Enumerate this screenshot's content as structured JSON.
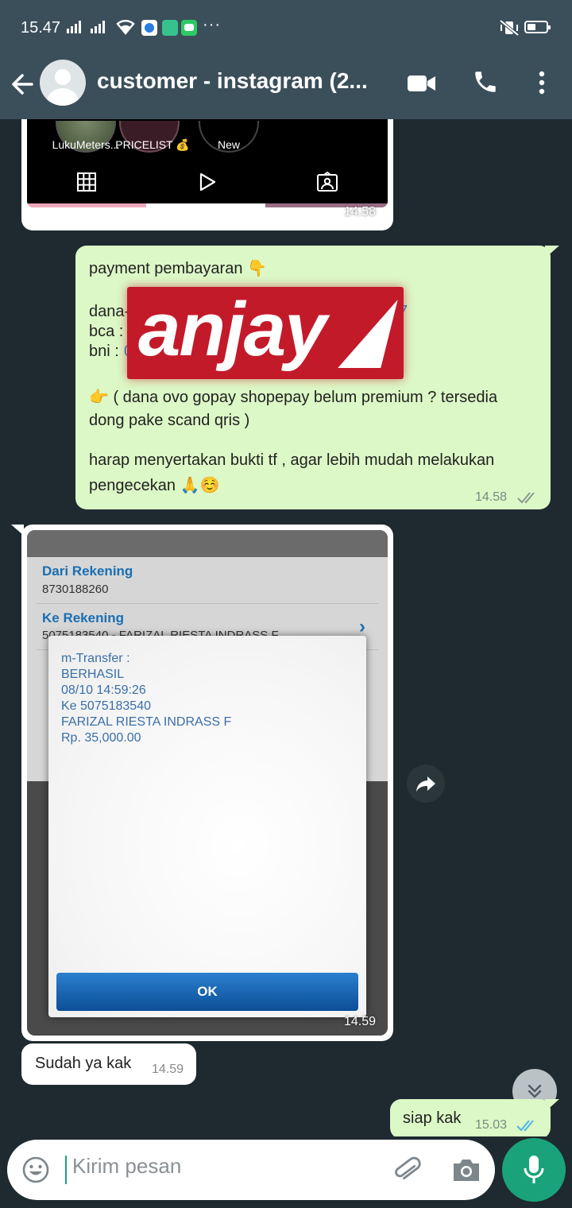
{
  "status_bar": {
    "time": "15.47",
    "more": "···"
  },
  "header": {
    "title": "customer - instagram (2..."
  },
  "instagram_preview": {
    "highlights": [
      "LukuMeters...",
      "PRICELIST 💰",
      "New"
    ],
    "time": "14.58"
  },
  "payment_message": {
    "line1": "payment pembayaran 👇",
    "dana": "dana-",
    "dana_end": "7",
    "bca": "bca :",
    "bni": "bni :",
    "bni_digit": "0",
    "sticker_text": "anjay",
    "note_line1": "👉 ( dana ovo gopay shopepay belum premium ? tersedia",
    "note_line2": "dong pake scand qris )",
    "thanks_line1": "harap menyertakan bukti tf , agar lebih mudah melakukan",
    "thanks_line2": "pengecekan 🙏☺️",
    "time": "14.58"
  },
  "transfer_image": {
    "from_label": "Dari Rekening",
    "from_value": "8730188260",
    "to_label": "Ke Rekening",
    "to_value": "5075183540 - FARIZAL RIESTA INDRASS F",
    "dialog_lines": [
      "m-Transfer :",
      "BERHASIL",
      "08/10 14:59:26",
      "Ke 5075183540",
      "FARIZAL RIESTA INDRASS F",
      "Rp. 35,000.00"
    ],
    "ok_label": "OK",
    "time": "14.59"
  },
  "incoming_reply": {
    "text": "Sudah ya kak",
    "time": "14.59"
  },
  "outgoing_reply": {
    "text": "siap kak",
    "time": "15.03"
  },
  "composer": {
    "placeholder": "Kirim pesan"
  },
  "colors": {
    "header": "#3b4f5b",
    "chat_background": "#1e2a30",
    "outgoing_bubble": "#dcf8c6",
    "incoming_bubble": "#ffffff",
    "accent": "#1aa37a",
    "read_ticks": "#4fb3e8"
  }
}
